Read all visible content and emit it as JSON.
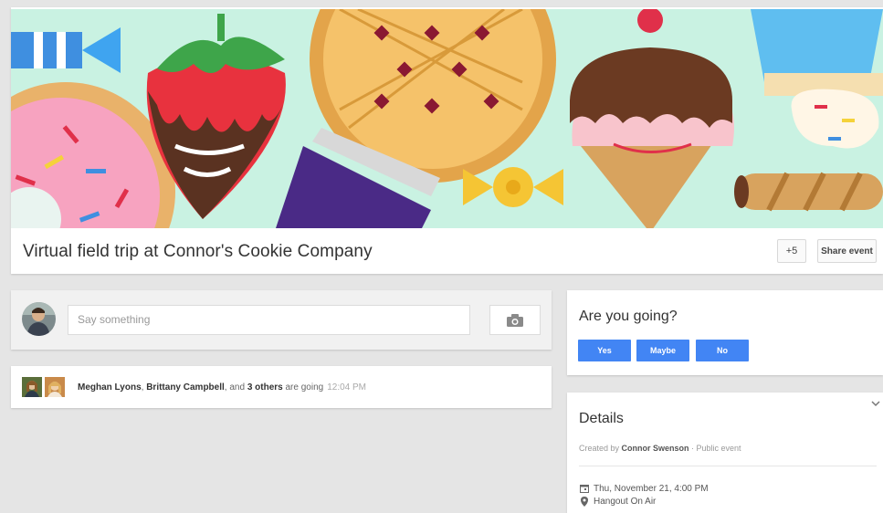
{
  "event": {
    "title": "Virtual field trip at Connor's Cookie Company",
    "plus_label": "+5",
    "share_label": "Share event"
  },
  "post": {
    "placeholder": "Say something"
  },
  "going": {
    "name1": "Meghan Lyons",
    "sep1": ", ",
    "name2": "Brittany Campbell",
    "sep2": ", and ",
    "others": "3 others",
    "suffix": " are going",
    "time": "12:04 PM"
  },
  "rsvp": {
    "question": "Are you going?",
    "yes": "Yes",
    "maybe": "Maybe",
    "no": "No",
    "button_color": "#4285f4"
  },
  "details": {
    "title": "Details",
    "created_prefix": "Created by ",
    "creator": "Connor Swenson",
    "visibility": " · Public event",
    "date": "Thu, November 21, 4:00 PM",
    "location": "Hangout On Air"
  },
  "icons": {
    "camera": "camera-icon",
    "calendar": "calendar-icon",
    "location": "location-pin-icon",
    "collapse": "chevron-down-icon"
  }
}
